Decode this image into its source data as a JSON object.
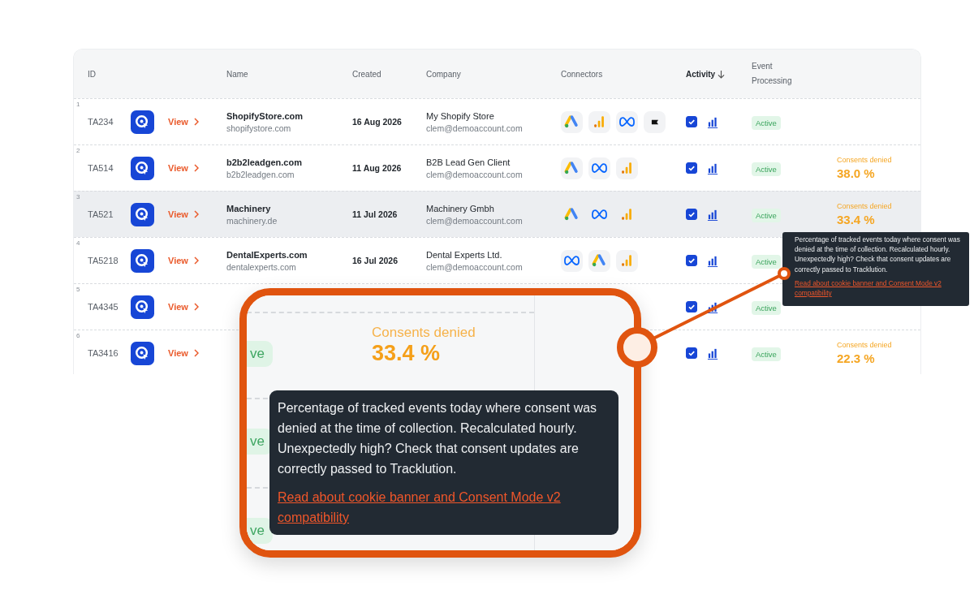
{
  "table": {
    "columns": [
      {
        "label": "ID"
      },
      {
        "label": "Name"
      },
      {
        "label": "Created"
      },
      {
        "label": "Company"
      },
      {
        "label": "Connectors"
      },
      {
        "label": "Activity",
        "sorted": true
      },
      {
        "label": "Event Processing"
      }
    ],
    "rows": [
      {
        "index": "1",
        "id": "TA234",
        "view": "View",
        "name": "ShopifyStore.com",
        "domain": "shopifystore.com",
        "created": "16 Aug 2026",
        "company": "My Shopify Store",
        "email": "clem@demoaccount.com",
        "connectors": [
          {
            "kind": "google_ads"
          },
          {
            "kind": "analytics"
          },
          {
            "kind": "meta"
          },
          {
            "kind": "flag"
          }
        ],
        "tracked": true,
        "status": "Active",
        "highlighted": false
      },
      {
        "index": "2",
        "id": "TA514",
        "view": "View",
        "name": "b2b2leadgen.com",
        "domain": "b2b2leadgen.com",
        "created": "11 Aug 2026",
        "company": "B2B Lead Gen Client",
        "email": "clem@demoaccount.com",
        "connectors": [
          {
            "kind": "google_ads"
          },
          {
            "kind": "meta"
          },
          {
            "kind": "analytics"
          }
        ],
        "tracked": true,
        "status": "Active",
        "consent_label": "Consents denied",
        "consent_value": "38.0 %",
        "highlighted": false
      },
      {
        "index": "3",
        "id": "TA521",
        "view": "View",
        "name": "Machinery",
        "domain": "machinery.de",
        "created": "11 Jul 2026",
        "company": "Machinery Gmbh",
        "email": "clem@demoaccount.com",
        "connectors": [
          {
            "kind": "google_ads"
          },
          {
            "kind": "meta"
          },
          {
            "kind": "analytics"
          }
        ],
        "tracked": true,
        "status": "Active",
        "consent_label": "Consents denied",
        "consent_value": "33.4 %",
        "highlighted": true
      },
      {
        "index": "4",
        "id": "TA5218",
        "view": "View",
        "name": "DentalExperts.com",
        "domain": "dentalexperts.com",
        "created": "16 Jul 2026",
        "company": "Dental Experts Ltd.",
        "email": "clem@demoaccount.com",
        "connectors": [
          {
            "kind": "meta"
          },
          {
            "kind": "google_ads"
          },
          {
            "kind": "analytics"
          }
        ],
        "tracked": true,
        "status": "Active",
        "highlighted": false
      },
      {
        "index": "5",
        "id": "TA4345",
        "view": "View",
        "tracked": true,
        "status": "Active",
        "highlighted": false
      },
      {
        "index": "6",
        "id": "TA3416",
        "view": "View",
        "tracked": true,
        "status": "Active",
        "consent_label": "Consents denied",
        "consent_value": "22.3 %",
        "highlighted": false
      }
    ]
  },
  "tooltip": {
    "text": "Percentage of tracked events today where consent was denied at the time of collection. Recalculated hourly. Unexpectedly high? Check that consent updates are correctly passed to Tracklution.",
    "link": "Read about cookie banner and Consent Mode v2 compatibility"
  },
  "magnifier": {
    "pills": [
      "ve",
      "ve",
      "ve"
    ],
    "consent_label": "Consents denied",
    "consent_value": "33.4 %",
    "tooltip": {
      "text": "Percentage of tracked events today where consent was denied at the time of collection. Recalculated hourly. Unexpectedly high? Check that consent updates are correctly passed to Tracklution.",
      "link": "Read about cookie banner and Consent Mode v2 compatibility"
    }
  }
}
